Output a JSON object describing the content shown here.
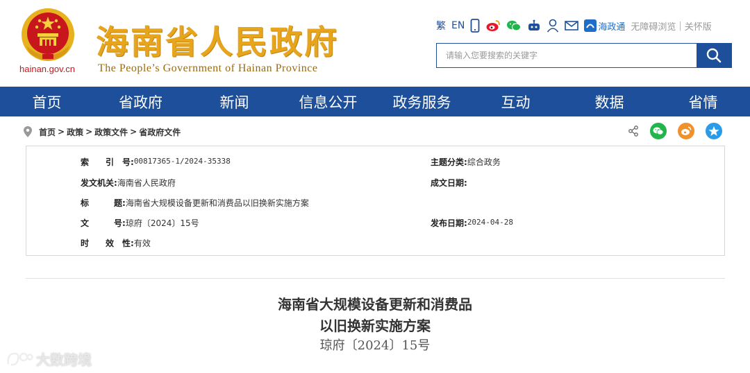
{
  "header": {
    "domain": "hainan.gov.cn",
    "title": "海南省人民政府",
    "subtitle": "The People’s Government  of Hainan Province",
    "toolbar": {
      "traditional": "繁",
      "english": "EN",
      "hzt_label": "海政通",
      "accessible": "无障碍浏览",
      "separator": "|",
      "care": "关怀版"
    },
    "search": {
      "placeholder": "请输入您要搜索的关键字"
    }
  },
  "nav": {
    "items": [
      {
        "label": "首页"
      },
      {
        "label": "省政府"
      },
      {
        "label": "新闻"
      },
      {
        "label": "信息公开"
      },
      {
        "label": "政务服务"
      },
      {
        "label": "互动"
      },
      {
        "label": "数据"
      },
      {
        "label": "省情"
      }
    ]
  },
  "breadcrumb": {
    "items": [
      "首页",
      "政策",
      "政策文件",
      "省政府文件"
    ],
    "separator": ">"
  },
  "info": {
    "index_label": "索　　引　号:",
    "index_value": "00817365-1/2024-35338",
    "topic_label": "主题分类:",
    "topic_value": "综合政务",
    "issuer_label": "发文机关:",
    "issuer_value": "海南省人民政府",
    "date_created_label": "成文日期:",
    "date_created_value": "",
    "title_label": "标　　　题:",
    "title_value": "海南省大规模设备更新和消费品以旧换新实施方案",
    "docno_label": "文　　　号:",
    "docno_value": "琼府〔2024〕15号",
    "publish_label": "发布日期:",
    "publish_value": "2024-04-28",
    "validity_label": "时　　效　性:",
    "validity_value": "有效"
  },
  "document": {
    "title_line1": "海南省大规模设备更新和消费品",
    "title_line2": "以旧换新实施方案",
    "number": "琼府〔2024〕15号"
  },
  "watermark": {
    "text": "大数跨境"
  },
  "colors": {
    "brand_blue": "#1e4f9a",
    "title_gold": "#e7a51d",
    "emblem_red": "#c8161d",
    "wechat_green": "#22b54b",
    "weibo_orange": "#f0912c",
    "qzone_blue": "#2a9be8"
  }
}
